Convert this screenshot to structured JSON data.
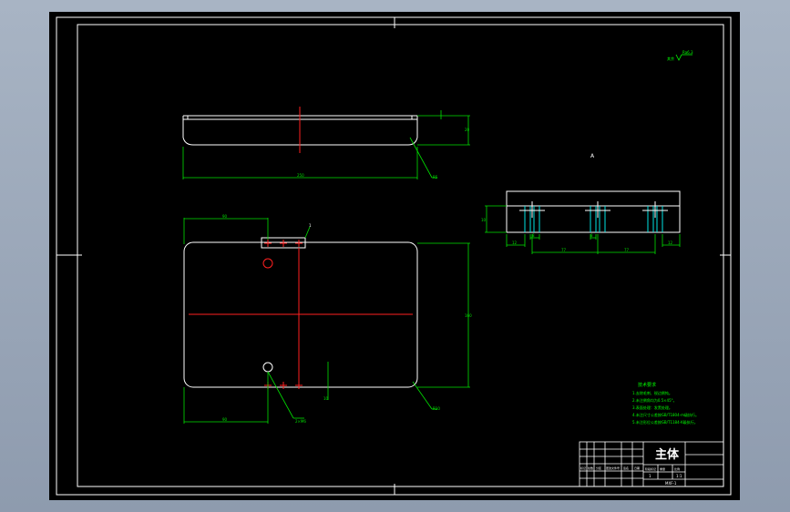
{
  "title_block": {
    "part_name": "主体",
    "scale_value": "1:1",
    "sheet_qty": "1",
    "drawing_no": "MXF-1",
    "header_cells": [
      "标记",
      "处数",
      "分区",
      "更改文件号",
      "签名",
      "日期"
    ],
    "lower_cells": [
      "阶段标记",
      "重量",
      "比例"
    ]
  },
  "technical_requirements": {
    "heading": "技术要求",
    "items": [
      "1.去除毛刺、锐边倒钝。",
      "2.未注倒角均为0.5×45°。",
      "3.表面处理：发黑处理。",
      "4.未注尺寸公差按GB/T1804-m级执行。",
      "5.未注形位公差按GB/T1184-K级执行。"
    ]
  },
  "surface_finish_note": {
    "prefix": "其余",
    "value": "Ra6.3"
  },
  "dimensions": {
    "top_view_width": "250",
    "top_view_height": "20",
    "front_view_height": "160",
    "front_view_left_offset": "90",
    "front_view_bottom_offset": "90",
    "hole_note": "2×M6",
    "hole_depth": "10",
    "side_view_spacing_1": "77",
    "side_view_spacing_2": "77",
    "side_view_edge_left": "12",
    "side_view_edge_right": "12",
    "side_view_small_1": "8",
    "side_view_small_2": "8",
    "side_view_depth": "10",
    "leader_note_1": "R5",
    "leader_note_2": "R10",
    "leader_note_3": "1"
  },
  "section_marker": "A",
  "colors": {
    "outline": "#ffffff",
    "centerline": "#ff2020",
    "dimension": "#00e000",
    "notes": "#00ff00",
    "hatch": "#00e5e5"
  }
}
